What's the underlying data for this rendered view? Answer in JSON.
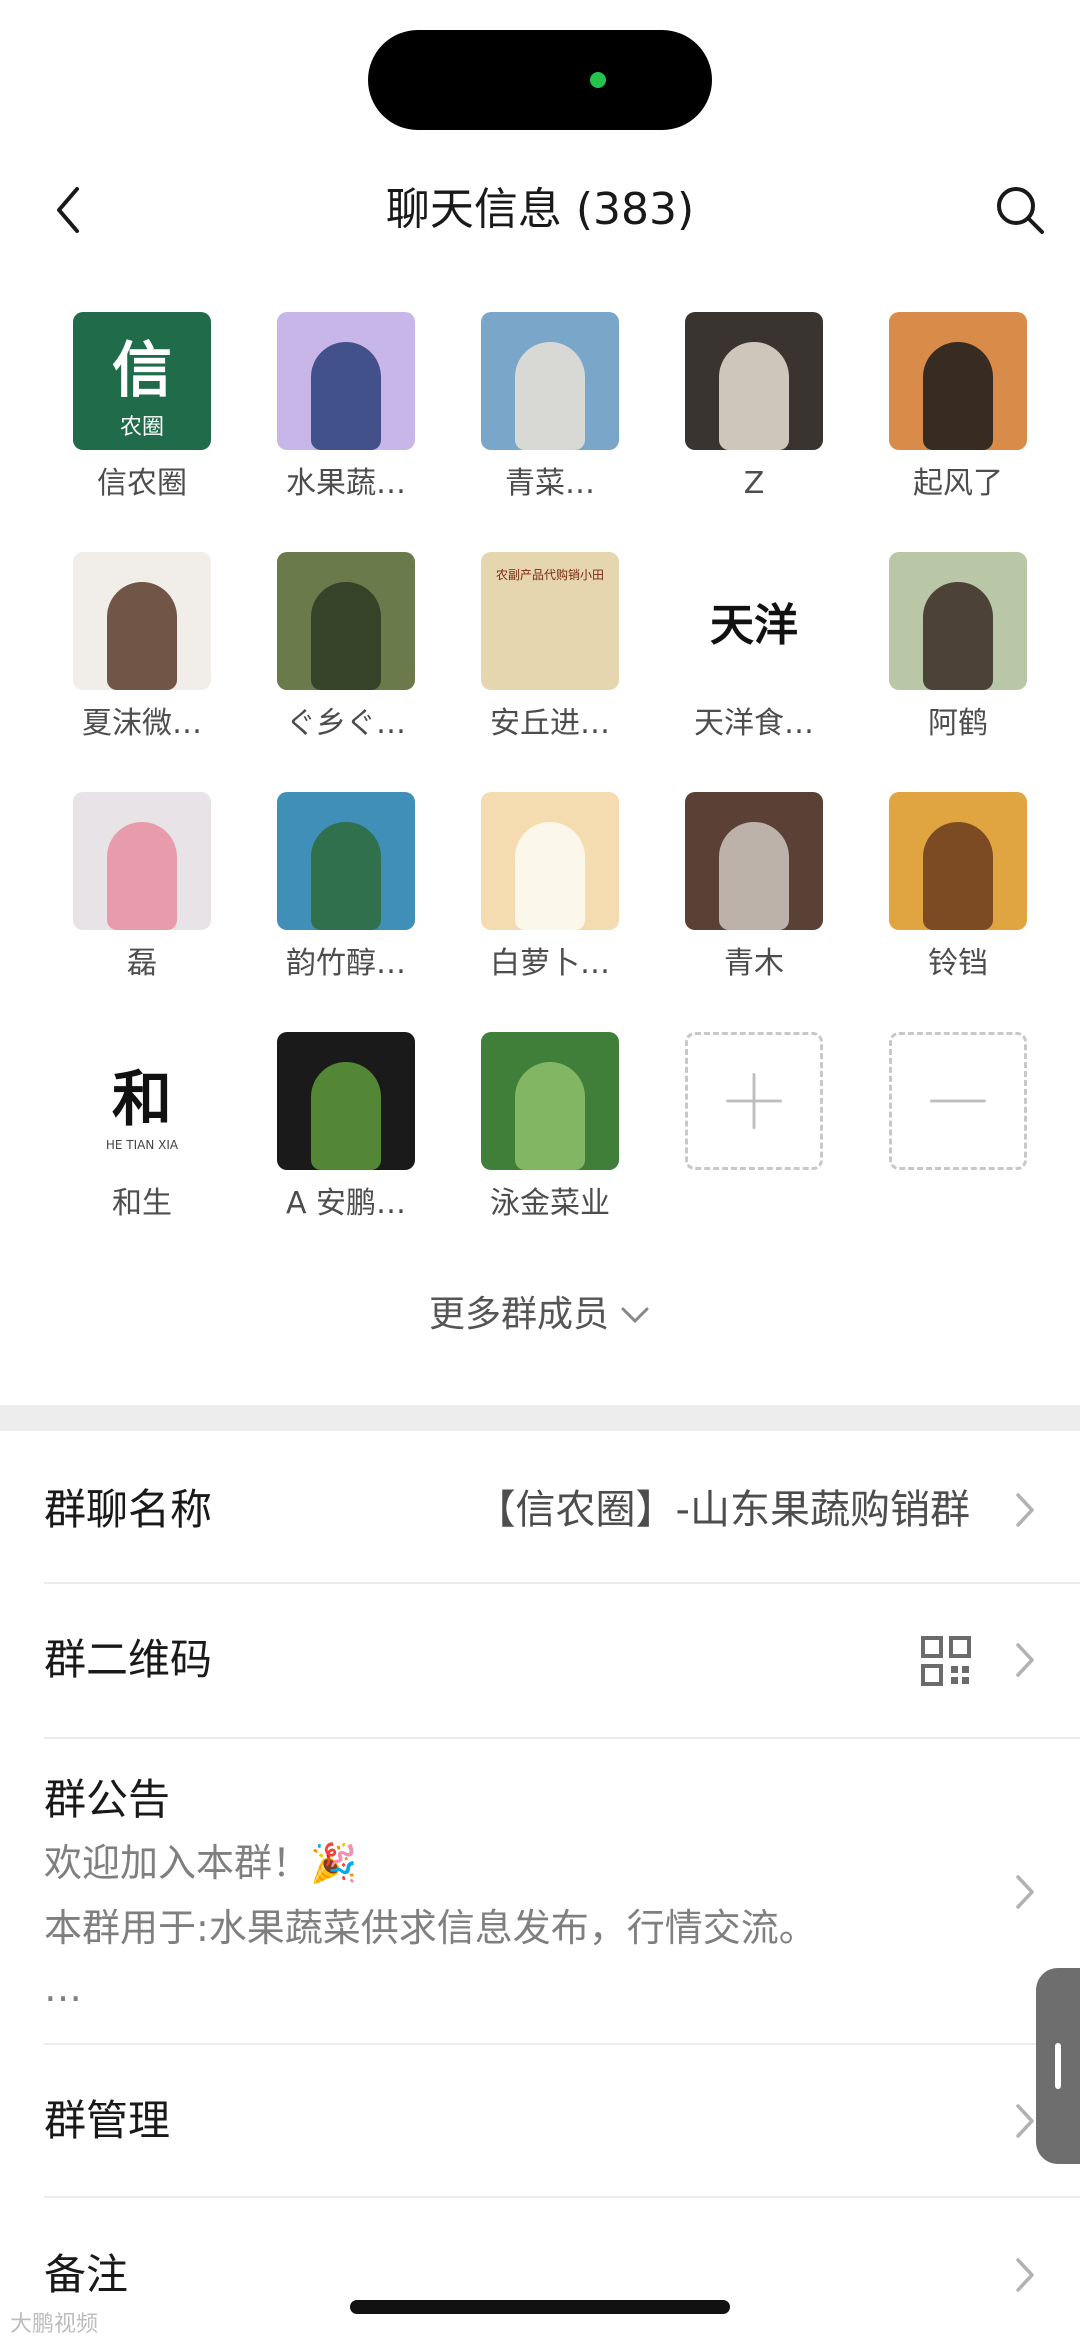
{
  "nav": {
    "title": "聊天信息 (383)"
  },
  "members": [
    {
      "name": "信农圈",
      "avatar": {
        "type": "logo",
        "bg": "#1f6b4a",
        "text": "信",
        "sub": "农圈"
      }
    },
    {
      "name": "水果蔬…",
      "avatar": {
        "type": "photo",
        "bg": "#c9b6e8",
        "fg": "#2b3f7a"
      }
    },
    {
      "name": "青菜…",
      "avatar": {
        "type": "photo",
        "bg": "#7aa6c9",
        "fg": "#e9e2d6"
      }
    },
    {
      "name": "Z",
      "avatar": {
        "type": "photo",
        "bg": "#3a3431",
        "fg": "#e8e1d2"
      }
    },
    {
      "name": "起风了",
      "avatar": {
        "type": "photo",
        "bg": "#d98b4a",
        "fg": "#1b1b1b"
      }
    },
    {
      "name": "夏沫微…",
      "avatar": {
        "type": "photo",
        "bg": "#f1ede8",
        "fg": "#5a3a2a"
      }
    },
    {
      "name": "ぐ乡ぐ…",
      "avatar": {
        "type": "photo",
        "bg": "#6b7a4a",
        "fg": "#2b3a22"
      }
    },
    {
      "name": "安丘进…",
      "avatar": {
        "type": "card",
        "bg": "#e6d6b0",
        "text": "农副产品代购销小田"
      }
    },
    {
      "name": "天洋食…",
      "avatar": {
        "type": "logo",
        "bg": "#ffffff",
        "text": "天洋",
        "sub": ""
      }
    },
    {
      "name": "阿鹤",
      "avatar": {
        "type": "photo",
        "bg": "#b9c7a6",
        "fg": "#3a2a24"
      }
    },
    {
      "name": "磊",
      "avatar": {
        "type": "photo",
        "bg": "#e8e3e6",
        "fg": "#e88fa0"
      }
    },
    {
      "name": "韵竹醇…",
      "avatar": {
        "type": "photo",
        "bg": "#3f8fb8",
        "fg": "#2f6b3a"
      }
    },
    {
      "name": "白萝卜…",
      "avatar": {
        "type": "photo",
        "bg": "#f4dcb0",
        "fg": "#fbfbf6"
      }
    },
    {
      "name": "青木",
      "avatar": {
        "type": "photo",
        "bg": "#5b4036",
        "fg": "#cfc7be"
      }
    },
    {
      "name": "铃铛",
      "avatar": {
        "type": "photo",
        "bg": "#e0a540",
        "fg": "#6a3b1e"
      }
    },
    {
      "name": "和生",
      "avatar": {
        "type": "logo",
        "bg": "#ffffff",
        "text": "和",
        "sub": "HE TIAN XIA"
      }
    },
    {
      "name": "A 安鹏…",
      "avatar": {
        "type": "photo",
        "bg": "#1a1a1a",
        "fg": "#5f9b3b"
      }
    },
    {
      "name": "泳金菜业",
      "avatar": {
        "type": "photo",
        "bg": "#3f7f3a",
        "fg": "#8fc06a"
      }
    }
  ],
  "more_members": "更多群成员",
  "settings": {
    "group_name_label": "群聊名称",
    "group_name_value": "【信农圈】-山东果蔬购销群",
    "qr_label": "群二维码",
    "notice_label": "群公告",
    "notice_line1": "欢迎加入本群！🎉",
    "notice_line2": "本群用于:水果蔬菜供求信息发布，行情交流。",
    "notice_line3": "…",
    "manage_label": "群管理",
    "remark_label": "备注"
  },
  "watermark": "大鹏视频",
  "colors": {
    "status_dot": "#27c24c",
    "separator": "#ededed"
  }
}
